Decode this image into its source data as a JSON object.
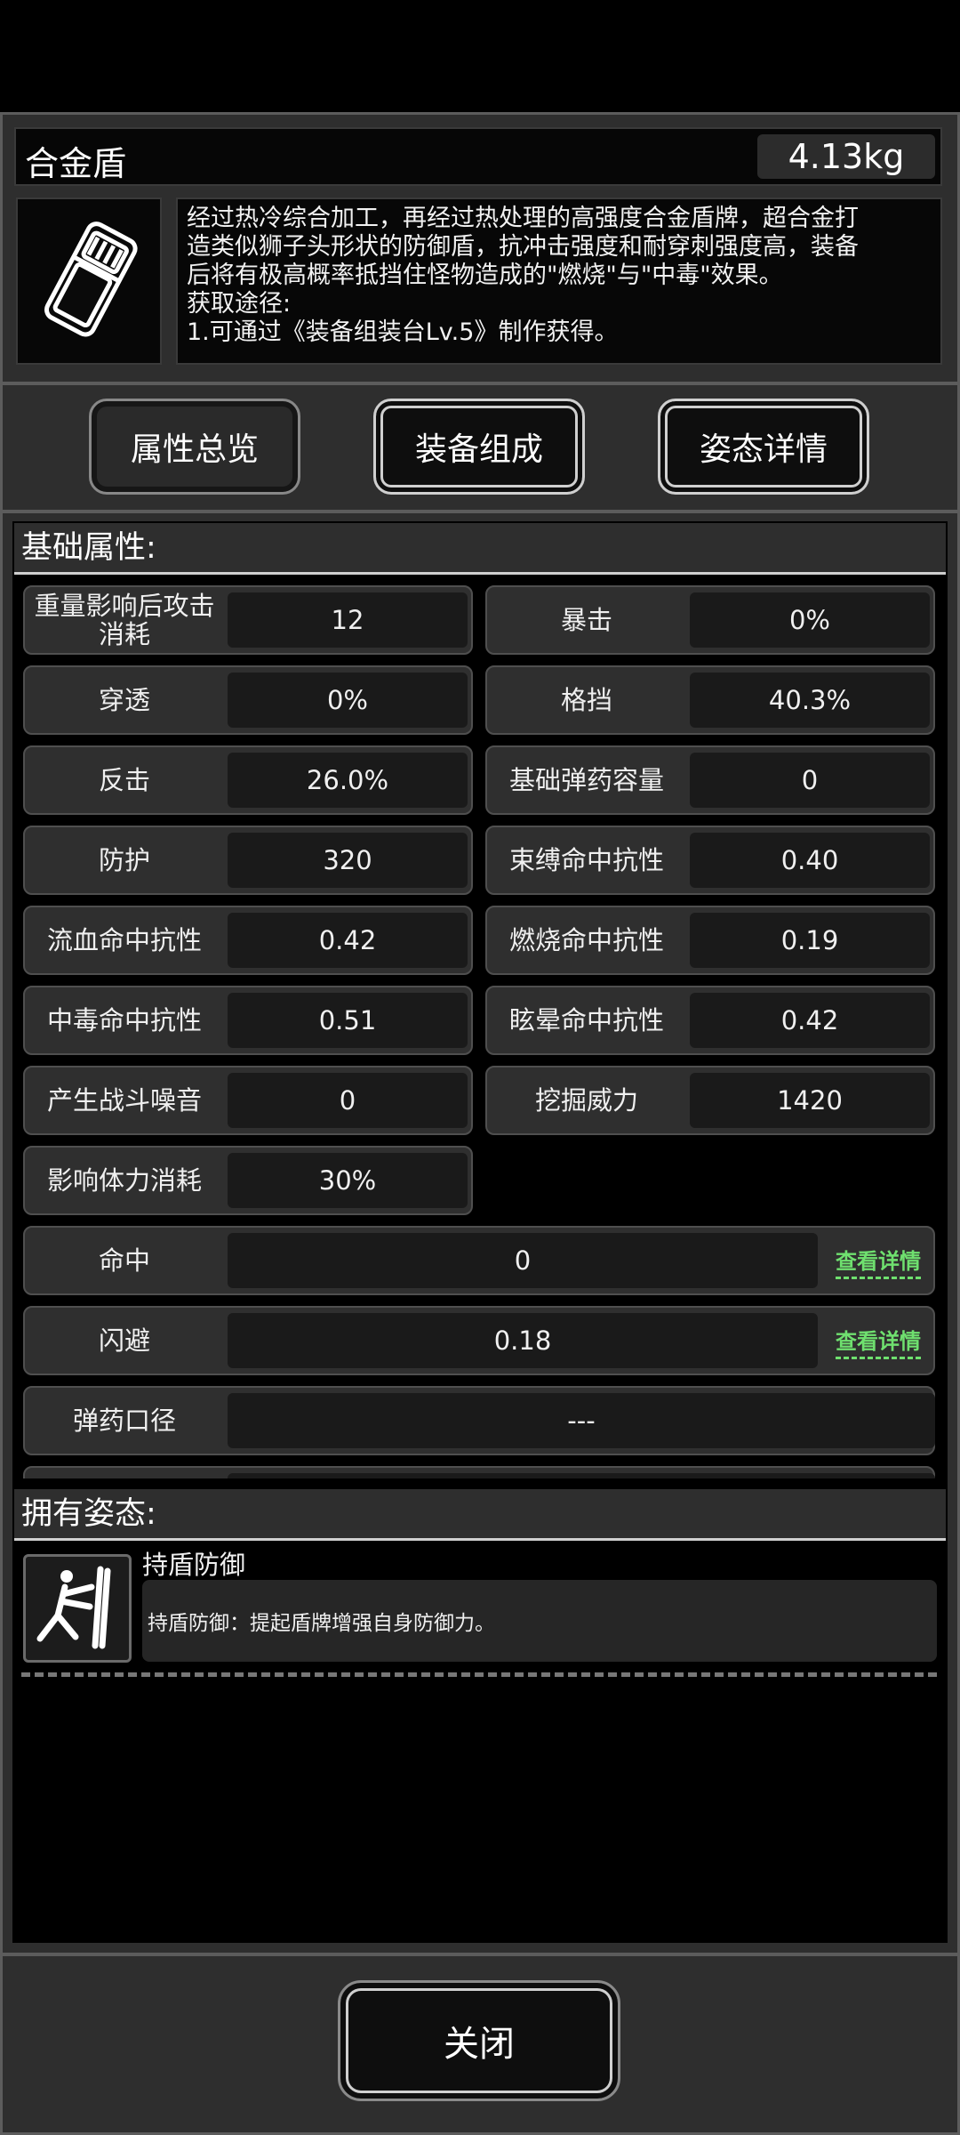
{
  "item": {
    "name": "合金盾",
    "weight": "4.13kg",
    "description_lines": [
      "经过热冷综合加工，再经过热处理的高强度合金盾牌，超合金打",
      "造类似狮子头形状的防御盾，抗冲击强度和耐穿刺强度高，装备",
      "后将有极高概率抵挡住怪物造成的\"燃烧\"与\"中毒\"效果。",
      "获取途径:",
      "1.可通过《装备组装台Lv.5》制作获得。"
    ],
    "icon": "shield-icon"
  },
  "tabs": [
    {
      "label": "属性总览",
      "active": true
    },
    {
      "label": "装备组成",
      "active": false
    },
    {
      "label": "姿态详情",
      "active": false
    }
  ],
  "attributes_header": "基础属性:",
  "attributes": [
    {
      "label": "重量影响后攻击消耗",
      "value": "12"
    },
    {
      "label": "暴击",
      "value": "0%"
    },
    {
      "label": "穿透",
      "value": "0%"
    },
    {
      "label": "格挡",
      "value": "40.3%"
    },
    {
      "label": "反击",
      "value": "26.0%"
    },
    {
      "label": "基础弹药容量",
      "value": "0"
    },
    {
      "label": "防护",
      "value": "320"
    },
    {
      "label": "束缚命中抗性",
      "value": "0.40"
    },
    {
      "label": "流血命中抗性",
      "value": "0.42"
    },
    {
      "label": "燃烧命中抗性",
      "value": "0.19"
    },
    {
      "label": "中毒命中抗性",
      "value": "0.51"
    },
    {
      "label": "眩晕命中抗性",
      "value": "0.42"
    },
    {
      "label": "产生战斗噪音",
      "value": "0"
    },
    {
      "label": "挖掘威力",
      "value": "1420"
    },
    {
      "label": "影响体力消耗",
      "value": "30%"
    }
  ],
  "wide_attributes": [
    {
      "label": "命中",
      "value": "0",
      "link": "查看详情"
    },
    {
      "label": "闪避",
      "value": "0.18",
      "link": "查看详情"
    },
    {
      "label": "弹药口径",
      "value": "---"
    }
  ],
  "stance_header": "拥有姿态:",
  "stance": {
    "name": "持盾防御",
    "description": "持盾防御：提起盾牌增强自身防御力。",
    "icon": "shield-stance-icon"
  },
  "close_label": "关闭"
}
